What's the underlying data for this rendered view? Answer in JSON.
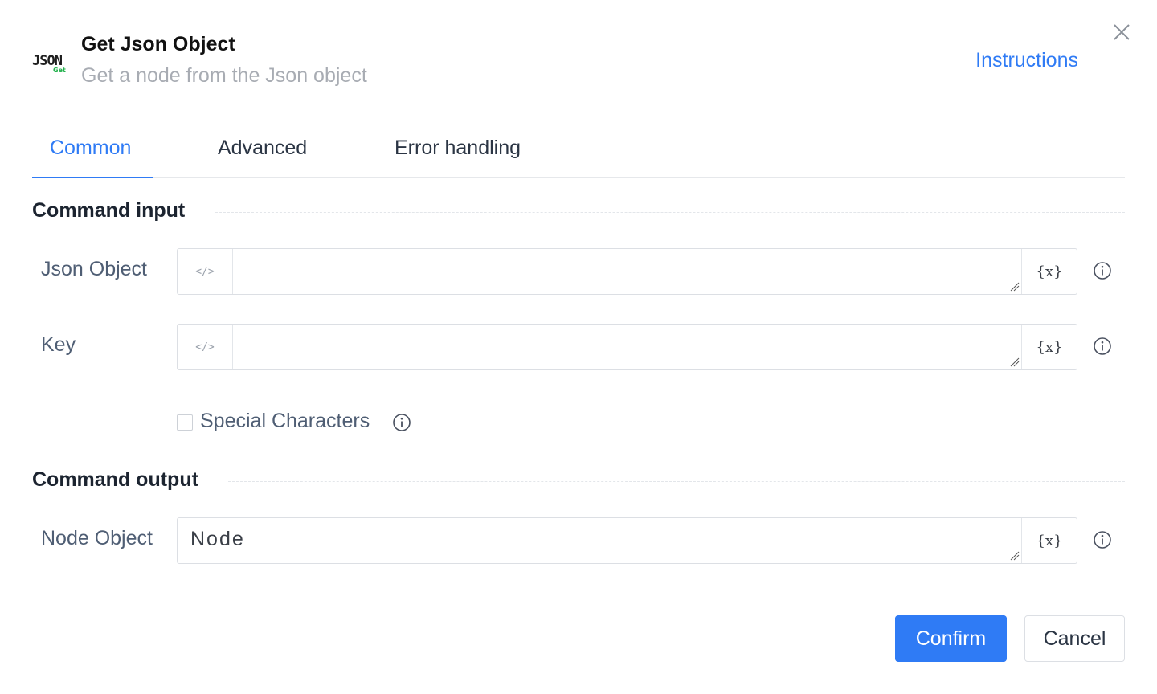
{
  "header": {
    "logo_text": "JSON",
    "logo_badge": "Get",
    "title": "Get Json Object",
    "subtitle": "Get a node from the Json object",
    "instructions_label": "Instructions"
  },
  "tabs": [
    {
      "label": "Common",
      "active": true
    },
    {
      "label": "Advanced",
      "active": false
    },
    {
      "label": "Error handling",
      "active": false
    }
  ],
  "command_input": {
    "section_title": "Command input",
    "fields": [
      {
        "label": "Json Object",
        "value": "",
        "variable_button": "{x}"
      },
      {
        "label": "Key",
        "value": "",
        "variable_button": "{x}"
      }
    ],
    "special_characters": {
      "label": "Special Characters",
      "checked": false
    }
  },
  "command_output": {
    "section_title": "Command output",
    "fields": [
      {
        "label": "Node Object",
        "value": "Node",
        "variable_button": "{x}"
      }
    ]
  },
  "footer": {
    "confirm_label": "Confirm",
    "cancel_label": "Cancel"
  },
  "icons": {
    "close": "close-icon",
    "code": "code-icon",
    "variable": "variable-icon",
    "info": "info-icon"
  },
  "colors": {
    "accent": "#2f7bf5",
    "logo_badge": "#22b14c"
  }
}
